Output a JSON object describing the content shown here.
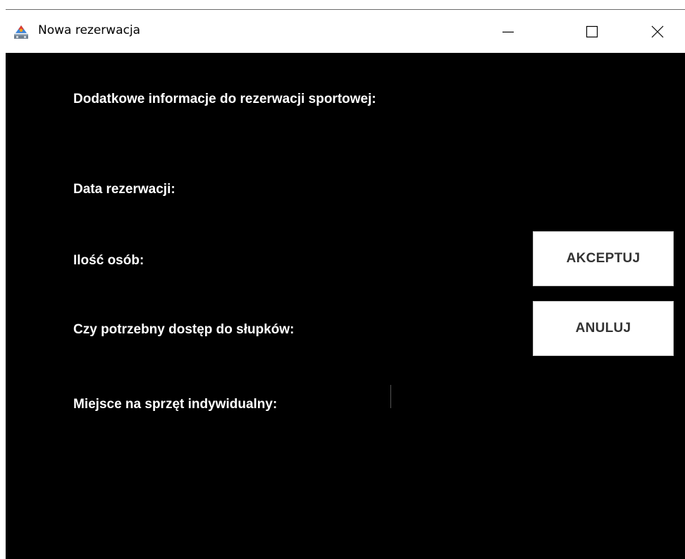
{
  "window": {
    "title": "Nowa rezerwacja",
    "app_icon": "java-app-icon",
    "controls": {
      "minimize_icon": "minimize-icon",
      "maximize_icon": "maximize-icon",
      "close_icon": "close-icon"
    }
  },
  "form": {
    "header": "Dodatkowe informacje do rezerwacji sportowej:",
    "labels": {
      "date": "Data rezerwacji:",
      "people": "Ilość osób:",
      "posts_access": "Czy potrzebny dostęp do słupków:",
      "equipment_space": "Miejsce na sprzęt indywidualny:"
    }
  },
  "buttons": {
    "accept_label": "AKCEPTUJ",
    "cancel_label": "ANULUJ"
  },
  "colors": {
    "content_background": "#000000",
    "label_text": "#ffffff",
    "button_background": "#ffffff",
    "button_text": "#333333"
  }
}
